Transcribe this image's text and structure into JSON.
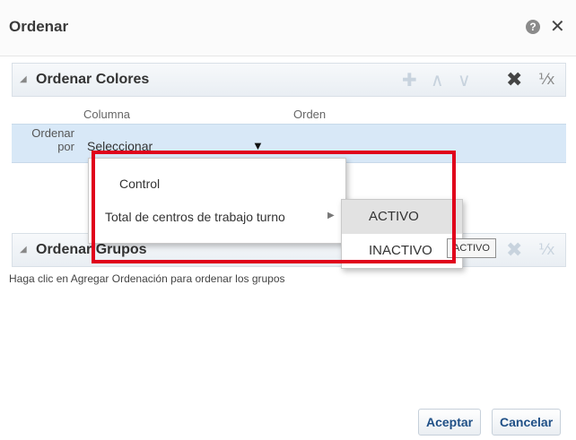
{
  "dialog": {
    "title": "Ordenar",
    "help_glyph": "?",
    "close_glyph": "✕"
  },
  "colors_panel": {
    "title": "Ordenar Colores",
    "col_column": "Columna",
    "col_order": "Orden",
    "row_label": "Ordenar por",
    "select_value": "Seleccionar"
  },
  "groups_panel": {
    "title": "Ordenar Grupos",
    "hint": "Haga clic en Agregar Ordenación para ordenar los grupos"
  },
  "menu": {
    "items": [
      "Control",
      "Total de centros de trabajo turno"
    ]
  },
  "submenu": {
    "items": [
      "ACTIVO",
      "INACTIVO"
    ],
    "selected": "ACTIVO"
  },
  "tooltip": {
    "text": "ACTIVO"
  },
  "footer": {
    "accept": "Aceptar",
    "cancel": "Cancelar"
  },
  "colors": {
    "highlight": "#e0001b",
    "selected_row": "#d8e8f7",
    "button_text": "#1f4f86"
  },
  "icons": [
    "help-icon",
    "close-icon",
    "add-icon",
    "move-up-icon",
    "move-down-icon",
    "delete-icon",
    "clear-sort-icon",
    "collapse-triangle-icon",
    "dropdown-arrow-icon",
    "submenu-arrow-icon"
  ]
}
